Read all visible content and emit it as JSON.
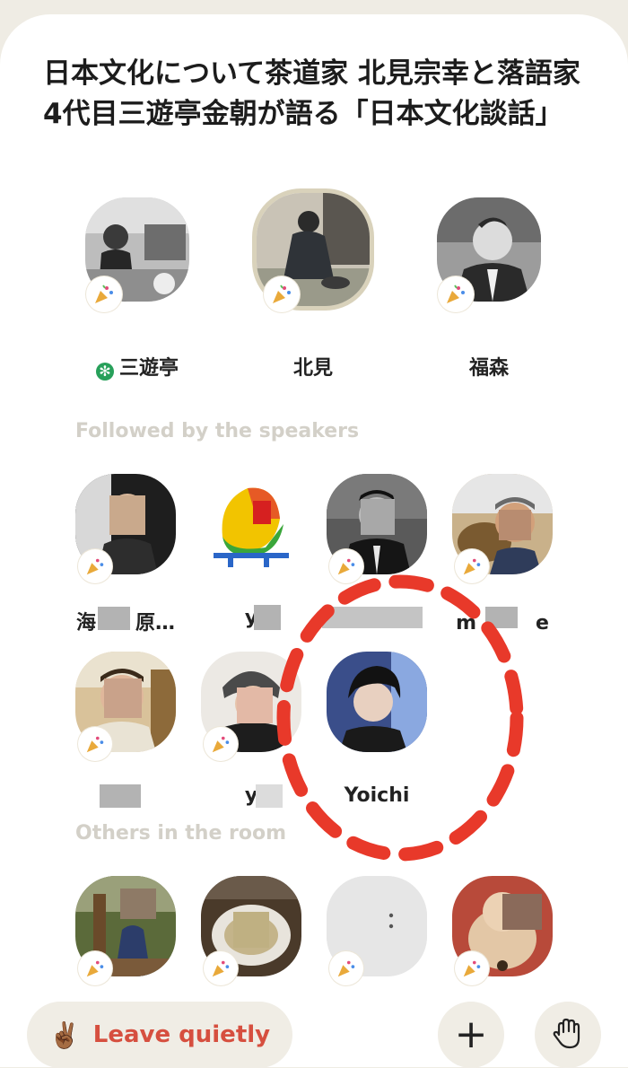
{
  "room": {
    "title": "日本文化について茶道家 北見宗幸と落語家 4代目三遊亭金朝が語る「日本文化談話」"
  },
  "speakers": [
    {
      "name": "三遊亭",
      "moderator": true
    },
    {
      "name": "北見",
      "moderator": false,
      "speaking": true
    },
    {
      "name": "福森",
      "moderator": false
    }
  ],
  "followed": {
    "label": "Followed by the speakers",
    "people": [
      {
        "name": "海　　原…"
      },
      {
        "name": "y"
      },
      {
        "name": ""
      },
      {
        "name": "m　　　e"
      },
      {
        "name": ""
      },
      {
        "name": "y"
      },
      {
        "name": "Yoichi"
      }
    ]
  },
  "others": {
    "label": "Others in the room",
    "people": [
      {
        "name": ""
      },
      {
        "name": ""
      },
      {
        "name": ""
      },
      {
        "name": ""
      }
    ]
  },
  "controls": {
    "leave_label": "Leave quietly",
    "leave_emoji": "✌🏾",
    "add_glyph": "+",
    "raise_hand_glyph": "✋"
  },
  "colors": {
    "accent_red": "#d64f3f",
    "highlight_circle": "#e8392a",
    "moderator_green": "#27a05a"
  }
}
